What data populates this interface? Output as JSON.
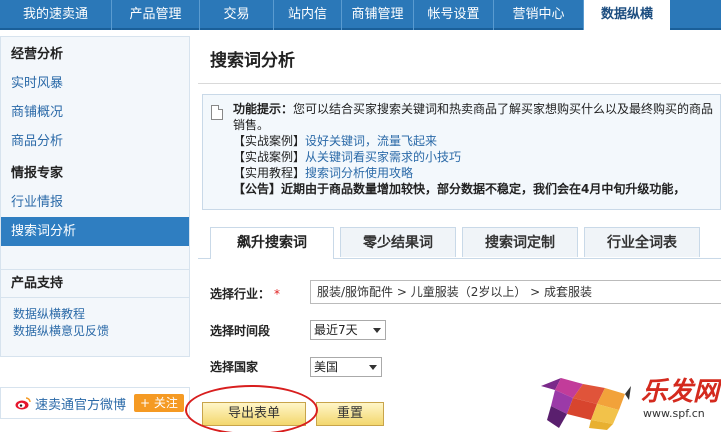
{
  "topnav": {
    "tabs": [
      "我的速卖通",
      "产品管理",
      "交易",
      "站内信",
      "商铺管理",
      "帐号设置",
      "营销中心",
      "数据纵横"
    ],
    "active_index": 7
  },
  "sidebar": {
    "section1_title": "经营分析",
    "section1_items": [
      "实时风暴",
      "商铺概况",
      "商品分析"
    ],
    "section2_title": "情报专家",
    "section2_items": [
      "行业情报",
      "搜索词分析"
    ],
    "active_item": "搜索词分析",
    "support_title": "产品支持",
    "support_links": [
      "数据纵横教程",
      "数据纵横意见反馈"
    ],
    "weibo_text": "速卖通官方微博",
    "follow_label": "+ 关注"
  },
  "main": {
    "title": "搜索词分析",
    "notice": {
      "label": "功能提示：",
      "text": "您可以结合买家搜索关键词和热卖商品了解买家想购买什么以及最终购买的商品",
      "text_cont": "销售。",
      "case1_prefix": "【实战案例】",
      "case1_link": "设好关键词，流量飞起来",
      "case2_prefix": "【实战案例】",
      "case2_link": "从关键词看买家需求的小技巧",
      "tutorial_prefix": "【实用教程】",
      "tutorial_link": "搜索词分析使用攻略",
      "announce_prefix": "【公告】",
      "announce_text": "近期由于商品数量增加较快，部分数据不稳定，我们会在4月中旬升级功能，"
    },
    "tabs": [
      "飙升搜索词",
      "零少结果词",
      "搜索词定制",
      "行业全词表"
    ],
    "active_tab": 0,
    "form": {
      "industry_label": "选择行业：",
      "required_mark": "*",
      "industry_value": "服装/服饰配件  > 儿童服装（2岁以上）  > 成套服装",
      "period_label": "选择时间段",
      "period_value": "最近7天",
      "country_label": "选择国家",
      "country_value": "美国"
    },
    "export_button": "导出表单",
    "reset_button": "重置"
  },
  "watermark": {
    "brand": "乐发网",
    "url": "www.spf.cn"
  },
  "colors": {
    "nav_blue": "#2b78b8",
    "link_blue": "#2b6aa8",
    "highlight_red": "#d81e1e",
    "button_gold": "#f3d76e"
  }
}
